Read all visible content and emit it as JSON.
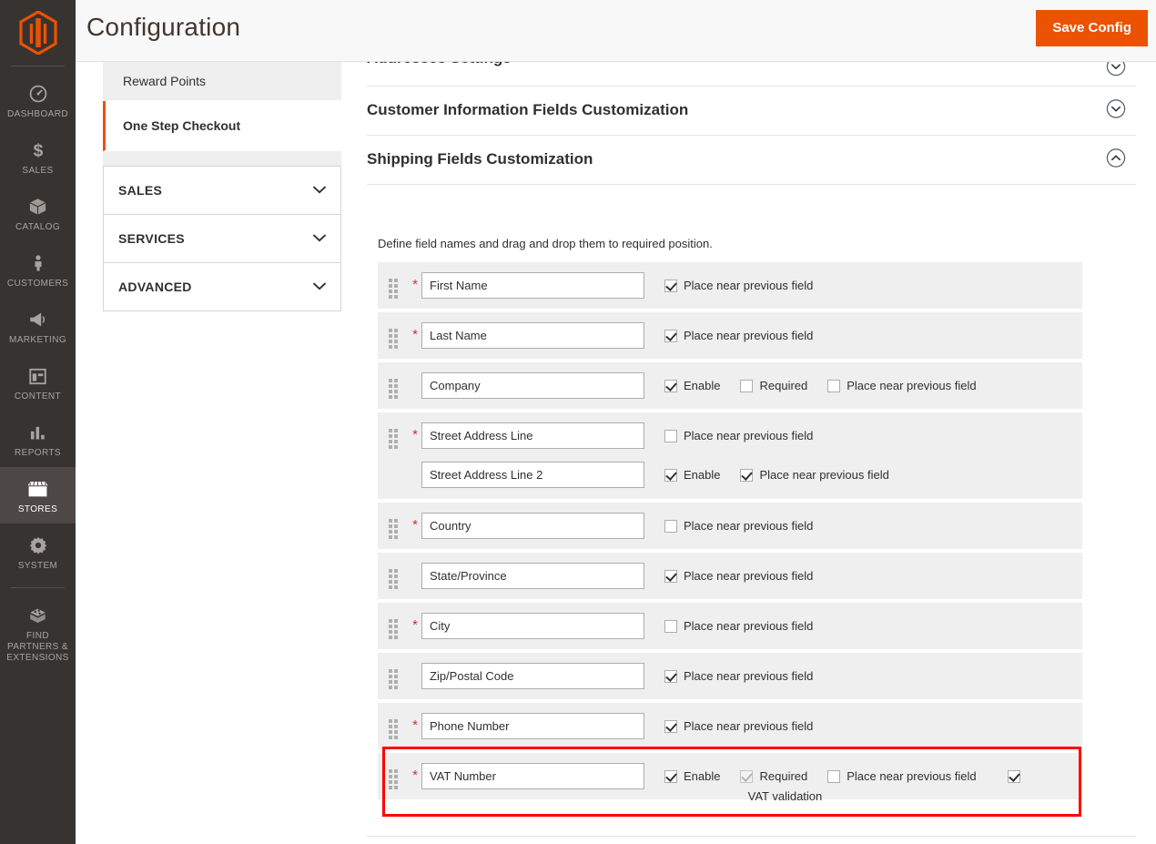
{
  "colors": {
    "accent": "#eb5202",
    "rail_bg": "#373330",
    "highlight": "#ff0000",
    "row_bg": "#efefef"
  },
  "header": {
    "title": "Configuration",
    "save_label": "Save Config"
  },
  "admin_rail": {
    "logo": "magento-logo",
    "items": [
      {
        "label": "DASHBOARD",
        "icon": "dashboard-icon",
        "active": false
      },
      {
        "label": "SALES",
        "icon": "dollar-icon",
        "active": false
      },
      {
        "label": "CATALOG",
        "icon": "box-icon",
        "active": false
      },
      {
        "label": "CUSTOMERS",
        "icon": "person-icon",
        "active": false
      },
      {
        "label": "MARKETING",
        "icon": "megaphone-icon",
        "active": false
      },
      {
        "label": "CONTENT",
        "icon": "layout-icon",
        "active": false
      },
      {
        "label": "REPORTS",
        "icon": "bar-chart-icon",
        "active": false
      },
      {
        "label": "STORES",
        "icon": "storefront-icon",
        "active": true
      },
      {
        "label": "SYSTEM",
        "icon": "gear-icon",
        "active": false
      },
      {
        "label": "FIND PARTNERS & EXTENSIONS",
        "icon": "extensions-icon",
        "active": false
      }
    ]
  },
  "config_nav": {
    "sub_items": [
      {
        "label": "Reward Points",
        "current": false
      },
      {
        "label": "One Step Checkout",
        "current": true
      }
    ],
    "groups": [
      {
        "label": "SALES",
        "expanded": false
      },
      {
        "label": "SERVICES",
        "expanded": false
      },
      {
        "label": "ADVANCED",
        "expanded": false
      }
    ]
  },
  "main": {
    "sections": [
      {
        "title": "Addresses Settings",
        "expanded": false,
        "clipped": true
      },
      {
        "title": "Customer Information Fields Customization",
        "expanded": false,
        "clipped": false
      },
      {
        "title": "Shipping Fields Customization",
        "expanded": true,
        "clipped": false
      }
    ],
    "shipping_note": "Define field names and drag and drop them to required position.",
    "labels": {
      "enable": "Enable",
      "required": "Required",
      "place_near": "Place near previous field",
      "vat_validation": "VAT validation"
    },
    "field_rows": [
      {
        "name": "first-name",
        "required_star": true,
        "lines": [
          {
            "value": "First Name",
            "checks": [
              {
                "key": "place_near",
                "checked": true,
                "disabled": false
              }
            ]
          }
        ]
      },
      {
        "name": "last-name",
        "required_star": true,
        "lines": [
          {
            "value": "Last Name",
            "checks": [
              {
                "key": "place_near",
                "checked": true,
                "disabled": false
              }
            ]
          }
        ]
      },
      {
        "name": "company",
        "required_star": false,
        "lines": [
          {
            "value": "Company",
            "checks": [
              {
                "key": "enable",
                "checked": true,
                "disabled": false
              },
              {
                "key": "required",
                "checked": false,
                "disabled": false
              },
              {
                "key": "place_near",
                "checked": false,
                "disabled": false
              }
            ]
          }
        ]
      },
      {
        "name": "street-address",
        "required_star": true,
        "lines": [
          {
            "value": "Street Address Line",
            "checks": [
              {
                "key": "place_near",
                "checked": false,
                "disabled": false
              }
            ]
          },
          {
            "value": "Street Address Line 2",
            "checks": [
              {
                "key": "enable",
                "checked": true,
                "disabled": false
              },
              {
                "key": "place_near",
                "checked": true,
                "disabled": false
              }
            ]
          }
        ]
      },
      {
        "name": "country",
        "required_star": true,
        "lines": [
          {
            "value": "Country",
            "checks": [
              {
                "key": "place_near",
                "checked": false,
                "disabled": false
              }
            ]
          }
        ]
      },
      {
        "name": "state-province",
        "required_star": false,
        "lines": [
          {
            "value": "State/Province",
            "checks": [
              {
                "key": "place_near",
                "checked": true,
                "disabled": false
              }
            ]
          }
        ]
      },
      {
        "name": "city",
        "required_star": true,
        "lines": [
          {
            "value": "City",
            "checks": [
              {
                "key": "place_near",
                "checked": false,
                "disabled": false
              }
            ]
          }
        ]
      },
      {
        "name": "zip-postal-code",
        "required_star": false,
        "lines": [
          {
            "value": "Zip/Postal Code",
            "checks": [
              {
                "key": "place_near",
                "checked": true,
                "disabled": false
              }
            ]
          }
        ]
      },
      {
        "name": "phone-number",
        "required_star": true,
        "lines": [
          {
            "value": "Phone Number",
            "checks": [
              {
                "key": "place_near",
                "checked": true,
                "disabled": false
              }
            ]
          }
        ]
      },
      {
        "name": "vat-number",
        "required_star": true,
        "highlighted": true,
        "lines": [
          {
            "value": "VAT Number",
            "checks": [
              {
                "key": "enable",
                "checked": true,
                "disabled": false
              },
              {
                "key": "required",
                "checked": true,
                "disabled": true
              },
              {
                "key": "place_near",
                "checked": false,
                "disabled": false
              },
              {
                "key": "vat_validation",
                "checked": true,
                "disabled": false,
                "label_below": true
              }
            ]
          }
        ]
      }
    ]
  }
}
